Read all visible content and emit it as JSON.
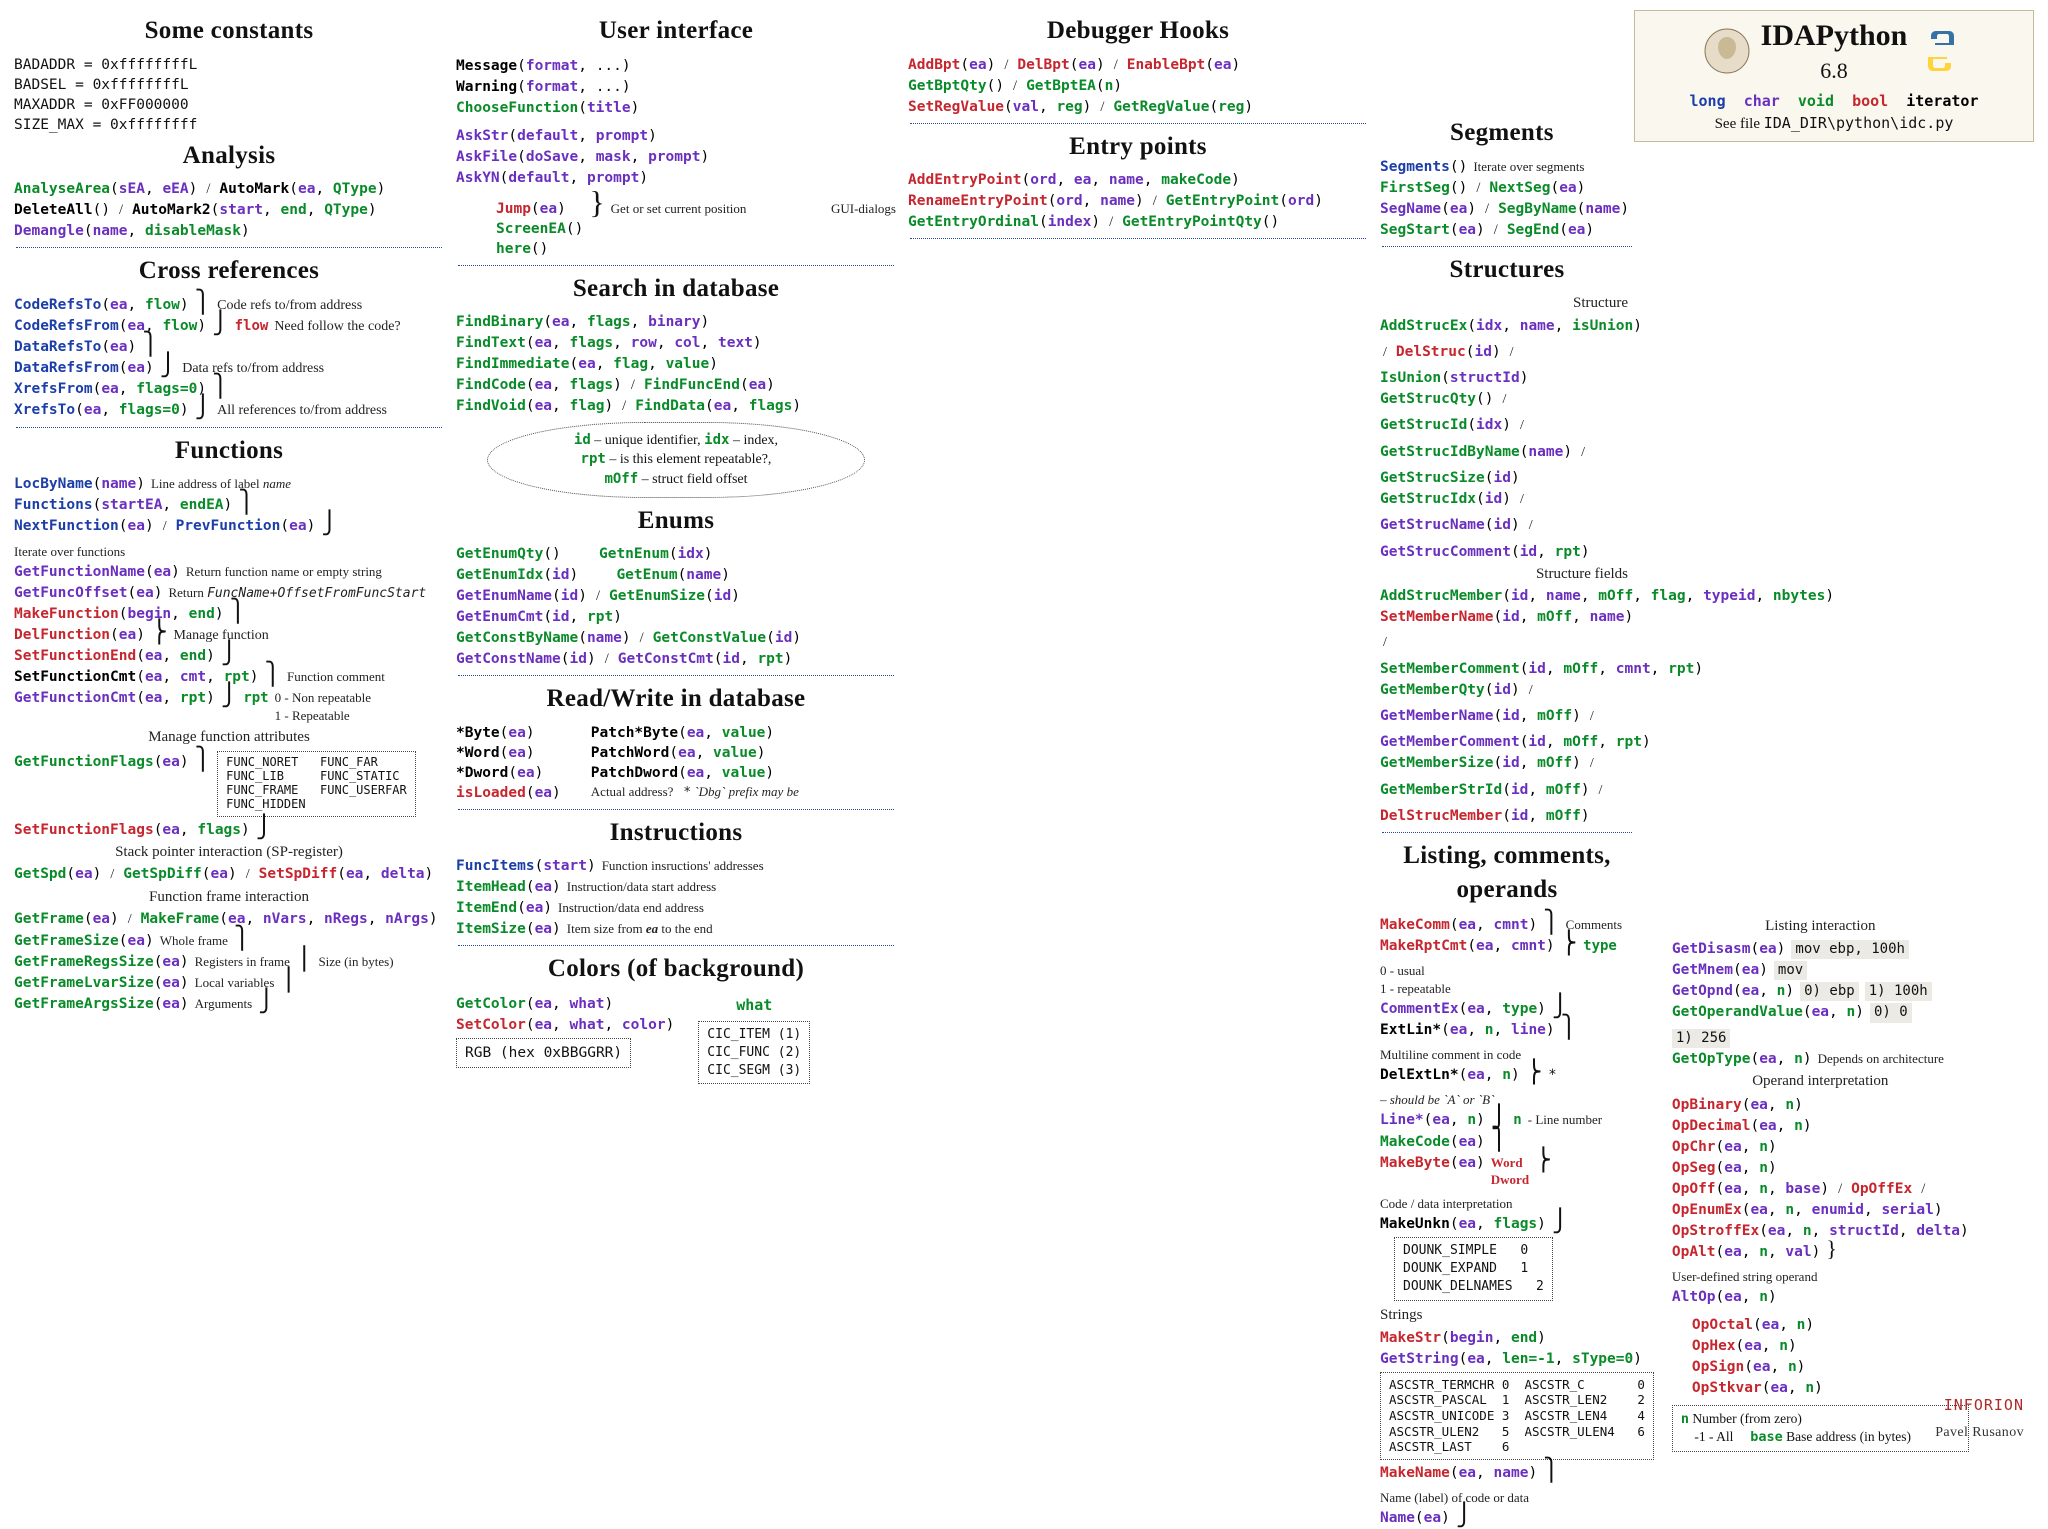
{
  "brand": {
    "title": "IDAPython",
    "version": "6.8",
    "types_long": "long",
    "types_char": "char",
    "types_void": "void",
    "types_bool": "bool",
    "types_iter": "iterator",
    "see": "See file ",
    "see_path": "IDA_DIR\\python\\idc.py"
  },
  "constants": {
    "title": "Some constants",
    "rows": [
      [
        "BADADDR",
        " = 0xffffffffL"
      ],
      [
        "BADSEL",
        " = 0xffffffffL"
      ],
      [
        "MAXADDR",
        " = 0xFF000000"
      ],
      [
        "SIZE_MAX",
        " = 0xffffffff"
      ]
    ]
  },
  "analysis": {
    "title": "Analysis",
    "sigs": {
      "AnalyseArea": [
        "sEA",
        "eEA"
      ],
      "AutoMark": [
        "ea",
        "QType"
      ],
      "DeleteAll": [],
      "AutoMark2": [
        "start",
        "end",
        "QType"
      ],
      "Demangle": [
        "name",
        "disableMask"
      ]
    }
  },
  "xrefs": {
    "title": "Cross references",
    "notes": {
      "refs": "Code refs to/from address",
      "flow_lbl": "flow",
      "flow": "Need follow the code?",
      "data": "Data refs to/from address",
      "all": "All references to/from address"
    },
    "sigs": {
      "CodeRefsTo": [
        "ea",
        "flow"
      ],
      "CodeRefsFrom": [
        "ea",
        "flow"
      ],
      "DataRefsTo": [
        "ea"
      ],
      "DataRefsFrom": [
        "ea"
      ],
      "XrefsFrom": [
        "ea",
        "flags=0"
      ],
      "XrefsTo": [
        "ea",
        "flags=0"
      ]
    }
  },
  "functions": {
    "title": "Functions",
    "notes": {
      "locbyname": "Line address of label ",
      "locbyname_it": "name",
      "iter": "Iterate over functions",
      "getname": "Return function name or empty string",
      "offset_pre": "Return ",
      "offset_it": "FuncName+OffsetFromFuncStart",
      "manage": "Manage function",
      "fnccmt": "Function comment",
      "rpt_lbl": "rpt",
      "rpt0": "0 - Non repeatable",
      "rpt1": "1 - Repeatable",
      "attrs": "Manage function attributes",
      "sp": "Stack pointer interaction (SP-register)",
      "frame": "Function frame interaction",
      "whole": "Whole frame",
      "regs": "Registers in frame",
      "locals": "Local variables",
      "args": "Arguments",
      "sizebytes": "Size (in bytes)"
    },
    "flagbox": [
      "FUNC_NORET",
      "FUNC_FAR",
      "FUNC_LIB",
      "FUNC_STATIC",
      "FUNC_FRAME",
      "FUNC_USERFAR",
      "FUNC_HIDDEN"
    ],
    "sigs": {
      "LocByName": [
        "name"
      ],
      "Functions": [
        "startEA",
        "endEA"
      ],
      "NextFunction": [
        "ea"
      ],
      "PrevFunction": [
        "ea"
      ],
      "GetFunctionName": [
        "ea"
      ],
      "GetFuncOffset": [
        "ea"
      ],
      "MakeFunction": [
        "begin",
        "end"
      ],
      "DelFunction": [
        "ea"
      ],
      "SetFunctionEnd": [
        "ea",
        "end"
      ],
      "SetFunctionCmt": [
        "ea",
        "cmt",
        "rpt"
      ],
      "GetFunctionCmt": [
        "ea",
        "rpt"
      ],
      "GetFunctionFlags": [
        "ea"
      ],
      "SetFunctionFlags": [
        "ea",
        "flags"
      ],
      "GetSpd": [
        "ea"
      ],
      "GetSpDiff": [
        "ea"
      ],
      "SetSpDiff": [
        "ea",
        "delta"
      ],
      "GetFrame": [
        "ea"
      ],
      "MakeFrame": [
        "ea",
        "nVars",
        "nRegs",
        "nArgs"
      ],
      "GetFrameSize": [
        "ea"
      ],
      "GetFrameRegsSize": [
        "ea"
      ],
      "GetFrameLvarSize": [
        "ea"
      ],
      "GetFrameArgsSize": [
        "ea"
      ]
    }
  },
  "ui": {
    "title": "User interface",
    "notes": {
      "pos": "Get or set current position",
      "dlg": "GUI-dialogs"
    },
    "sigs": {
      "Message": [
        "format",
        "..."
      ],
      "Warning": [
        "format",
        "..."
      ],
      "ChooseFunction": [
        "title"
      ],
      "AskStr": [
        "default",
        "prompt"
      ],
      "AskFile": [
        "doSave",
        "mask",
        "prompt"
      ],
      "AskYN": [
        "default",
        "prompt"
      ],
      "Jump": [
        "ea"
      ],
      "ScreenEA": [],
      "here": []
    }
  },
  "search": {
    "title": "Search in database",
    "sigs": {
      "FindBinary": [
        "ea",
        "flags",
        "binary"
      ],
      "FindText": [
        "ea",
        "flags",
        "row",
        "col",
        "text"
      ],
      "FindImmediate": [
        "ea",
        "flag",
        "value"
      ],
      "FindCode": [
        "ea",
        "flags"
      ],
      "FindFuncEnd": [
        "ea"
      ],
      "FindVoid": [
        "ea",
        "flag"
      ],
      "FindData": [
        "ea",
        "flags"
      ]
    }
  },
  "bubble": {
    "id": "id",
    "id_txt": " – unique identifier, ",
    "idx": "idx",
    "idx_txt": " – index,",
    "rpt": "rpt",
    "rpt_txt": " – is this element repeatable?,",
    "moff": "mOff",
    "moff_txt": " – struct field offset"
  },
  "enums": {
    "title": "Enums",
    "sigs": {
      "GetEnumQty": [],
      "GetnEnum": [
        "idx"
      ],
      "GetEnumIdx": [
        "id"
      ],
      "GetEnum": [
        "name"
      ],
      "GetEnumName": [
        "id"
      ],
      "GetEnumSize": [
        "id"
      ],
      "GetEnumCmt": [
        "id",
        "rpt"
      ],
      "GetConstByName": [
        "name"
      ],
      "GetConstValue": [
        "id"
      ],
      "GetConstName": [
        "id"
      ],
      "GetConstCmt": [
        "id",
        "rpt"
      ]
    }
  },
  "rw": {
    "title": "Read/Write in database",
    "notes": {
      "actual": "Actual address?",
      "dbg": " `Dbg` prefix may be",
      "star": "*"
    },
    "left": [
      [
        "*Byte",
        "ea"
      ],
      [
        "*Word",
        "ea"
      ],
      [
        "*Dword",
        "ea"
      ],
      [
        "isLoaded",
        "ea"
      ]
    ],
    "right": [
      [
        "Patch*Byte",
        "ea",
        "value"
      ],
      [
        "PatchWord",
        "ea",
        "value"
      ],
      [
        "PatchDword",
        "ea",
        "value"
      ]
    ]
  },
  "instructions": {
    "title": "Instructions",
    "sigs": {
      "FuncItems": [
        "start"
      ],
      "ItemHead": [
        "ea"
      ],
      "ItemEnd": [
        "ea"
      ],
      "ItemSize": [
        "ea"
      ]
    },
    "notes": {
      "funcitems": "Function insructions' addresses",
      "head": "Instruction/data start address",
      "end": "Instruction/data end address",
      "size_pre": "Item size from ",
      "size_it": "ea",
      "size_post": " to the end"
    }
  },
  "colors": {
    "title": "Colors (of background)",
    "sigs": {
      "GetColor": [
        "ea",
        "what"
      ],
      "SetColor": [
        "ea",
        "what",
        "color"
      ]
    },
    "what": "what",
    "cic": [
      "CIC_ITEM (1)",
      "CIC_FUNC (2)",
      "CIC_SEGM (3)"
    ],
    "rgb": "RGB (hex 0xBBGGRR)"
  },
  "dbg": {
    "title": "Debugger Hooks",
    "sigs": {
      "AddBpt": [
        "ea"
      ],
      "DelBpt": [
        "ea"
      ],
      "EnableBpt": [
        "ea"
      ],
      "GetBptQty": [],
      "GetBptEA": [
        "n"
      ],
      "SetRegValue": [
        "val",
        "reg"
      ],
      "GetRegValue": [
        "reg"
      ]
    }
  },
  "entry": {
    "title": "Entry points",
    "sigs": {
      "AddEntryPoint": [
        "ord",
        "ea",
        "name",
        "makeCode"
      ],
      "RenameEntryPoint": [
        "ord",
        "name"
      ],
      "GetEntryPoint": [
        "ord"
      ],
      "GetEntryOrdinal": [
        "index"
      ],
      "GetEntryPointQty": []
    }
  },
  "structs": {
    "title": "Structures",
    "sub_struct": "Structure",
    "sub_fields": "Structure fields",
    "sigs": {
      "AddStrucEx": [
        "idx",
        "name",
        "isUnion"
      ],
      "DelStruc": [
        "id"
      ],
      "IsUnion": [
        "structId"
      ],
      "GetStrucQty": [],
      "GetStrucId": [
        "idx"
      ],
      "GetStrucIdByName": [
        "name"
      ],
      "GetStrucSize": [
        "id"
      ],
      "GetStrucIdx": [
        "id"
      ],
      "GetStrucName": [
        "id"
      ],
      "GetStrucComment": [
        "id",
        "rpt"
      ],
      "AddStrucMember": [
        "id",
        "name",
        "mOff",
        "flag",
        "typeid",
        "nbytes"
      ],
      "SetMemberName": [
        "id",
        "mOff",
        "name"
      ],
      "SetMemberComment": [
        "id",
        "mOff",
        "cmnt",
        "rpt"
      ],
      "GetMemberQty": [
        "id"
      ],
      "GetMemberName": [
        "id",
        "mOff"
      ],
      "GetMemberComment": [
        "id",
        "mOff",
        "rpt"
      ],
      "GetMemberSize": [
        "id",
        "mOff"
      ],
      "GetMemberStrId": [
        "id",
        "mOff"
      ],
      "DelStrucMember": [
        "id",
        "mOff"
      ]
    }
  },
  "segments": {
    "title": "Segments",
    "note": "Iterate over segments",
    "sigs": {
      "Segments": [],
      "FirstSeg": [],
      "NextSeg": [
        "ea"
      ],
      "SegName": [
        "ea"
      ],
      "SegByName": [
        "name"
      ],
      "SegStart": [
        "ea"
      ],
      "SegEnd": [
        "ea"
      ]
    }
  },
  "listing": {
    "title": "Listing, comments, operands",
    "sub_listing": "Listing interaction",
    "sub_opnd": "Operand interpretation",
    "notes": {
      "comments": "Comments",
      "type": "type",
      "t0": "0 - usual",
      "t1": "1 - repeatable",
      "multi": "Multiline comment in code",
      "ab_star": "*",
      "ab": " – should be  `A` or `B`",
      "n": "n",
      "nline": " - Line number",
      "codedata": "Code / data interpretation",
      "strings": "Strings",
      "opstr": "User-defined string operand",
      "word": "Word",
      "dword": "Dword",
      "depends": "Depends on architecture",
      "namelbl": "Name (label) of code or data"
    },
    "sigs": {
      "MakeComm": [
        "ea",
        "cmnt"
      ],
      "MakeRptCmt": [
        "ea",
        "cmnt"
      ],
      "CommentEx": [
        "ea",
        "type"
      ],
      "ExtLin*": [
        "ea",
        "n",
        "line"
      ],
      "DelExtLn*": [
        "ea",
        "n"
      ],
      "Line*": [
        "ea",
        "n"
      ],
      "MakeCode": [
        "ea"
      ],
      "MakeByte": [
        "ea"
      ],
      "MakeUnkn": [
        "ea",
        "flags"
      ],
      "MakeStr": [
        "begin",
        "end"
      ],
      "GetString": [
        "ea",
        "len=-1",
        "sType=0"
      ],
      "GetDisasm": [
        "ea"
      ],
      "GetMnem": [
        "ea"
      ],
      "GetOpnd": [
        "ea",
        "n"
      ],
      "GetOperandValue": [
        "ea",
        "n"
      ],
      "GetOpType": [
        "ea",
        "n"
      ],
      "OpBinary": [
        "ea",
        "n"
      ],
      "OpDecimal": [
        "ea",
        "n"
      ],
      "OpChr": [
        "ea",
        "n"
      ],
      "OpSeg": [
        "ea",
        "n"
      ],
      "OpOff": [
        "ea",
        "n",
        "base"
      ],
      "OpOffEx": [
        ""
      ],
      "OpOctal": [
        "ea",
        "n"
      ],
      "OpHex": [
        "ea",
        "n"
      ],
      "OpSign": [
        "ea",
        "n"
      ],
      "OpStkvar": [
        "ea",
        "n"
      ],
      "OpEnumEx": [
        "ea",
        "n",
        "enumid",
        "serial"
      ],
      "OpStroffEx": [
        "ea",
        "n",
        "structId",
        "delta"
      ],
      "OpAlt": [
        "ea",
        "n",
        "val"
      ],
      "AltOp": [
        "ea",
        "n"
      ],
      "MakeName": [
        "ea",
        "name"
      ],
      "Name": [
        "ea"
      ]
    },
    "dounk": [
      [
        "DOUNK_SIMPLE",
        "0"
      ],
      [
        "DOUNK_EXPAND",
        "1"
      ],
      [
        "DOUNK_DELNAMES",
        "2"
      ]
    ],
    "ascstr": [
      [
        "ASCSTR_TERMCHR",
        "0"
      ],
      [
        "ASCSTR_C",
        "0"
      ],
      [
        "ASCSTR_PASCAL",
        "1"
      ],
      [
        "ASCSTR_LEN2",
        "2"
      ],
      [
        "ASCSTR_UNICODE",
        "3"
      ],
      [
        "ASCSTR_LEN4",
        "4"
      ],
      [
        "ASCSTR_ULEN2",
        "5"
      ],
      [
        "ASCSTR_ULEN4",
        "6"
      ],
      [
        "ASCSTR_LAST",
        "6"
      ]
    ],
    "ex": {
      "disasm": "mov  ebp, 100h",
      "mnem": "mov",
      "opnd0": "0) ebp",
      "opnd1": "1) 100h",
      "val0": "0) 0",
      "val1": "1) 256"
    },
    "legend": {
      "n": "n",
      "n_txt": " Number (from zero)\n   -1 - All",
      "base": "base",
      "base_txt": " Base address (in bytes)"
    }
  },
  "footer": {
    "author": "Pavel Rusanov",
    "logo": "INFORION"
  }
}
